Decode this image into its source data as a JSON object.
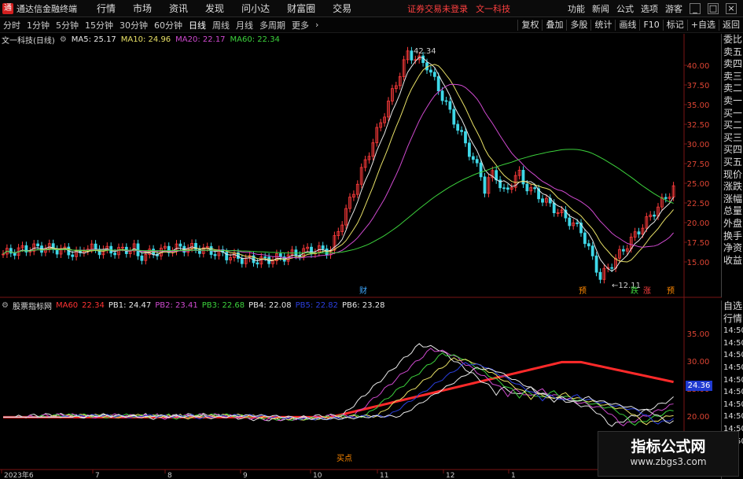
{
  "menubar": {
    "logo": "通",
    "app_title": "通达信金融终端",
    "items": [
      "行情",
      "市场",
      "资讯",
      "发现",
      "问小达",
      "财富圈",
      "交易"
    ],
    "notice": "证券交易未登录",
    "stock_name": "文一科技",
    "right_items": [
      "功能",
      "新闻",
      "公式",
      "选项",
      "游客"
    ]
  },
  "periods": [
    "分时",
    "1分钟",
    "5分钟",
    "15分钟",
    "30分钟",
    "60分钟",
    "日线",
    "周线",
    "月线",
    "多周期",
    "更多"
  ],
  "active_period": "日线",
  "toolbar": [
    "复权",
    "叠加",
    "多股",
    "统计",
    "画线",
    "F10",
    "标记",
    "+自选",
    "返回"
  ],
  "main_legend": {
    "title": "文一科技(日线)",
    "ma5": "MA5: 25.17",
    "ma10": "MA10: 24.96",
    "ma20": "MA20: 22.17",
    "ma60": "MA60: 22.34"
  },
  "sub_legend": {
    "title": "股票指标网",
    "ma60": "MA60",
    "ma60_val": "22.34",
    "pb1": "PB1: 24.47",
    "pb2": "PB2: 23.41",
    "pb3": "PB3: 22.68",
    "pb4": "PB4: 22.08",
    "pb5": "PB5: 22.82",
    "pb6": "PB6: 23.28"
  },
  "annotations": {
    "high": "42.34",
    "low": "12.11",
    "marker1": "财",
    "marker2": "预",
    "marker3": "跌",
    "marker4": "涨",
    "marker5": "预",
    "sub_marker": "买点",
    "price_tag": "24.36"
  },
  "main_axis": [
    "40.00",
    "37.50",
    "35.00",
    "32.50",
    "30.00",
    "27.50",
    "25.00",
    "22.50",
    "20.00",
    "17.50",
    "15.00"
  ],
  "sub_axis": [
    "35.00",
    "30.00",
    "25.00",
    "20.00"
  ],
  "time_axis": [
    "2023年6",
    "7",
    "8",
    "9",
    "10",
    "11",
    "12",
    "1"
  ],
  "sidebar_main": [
    "委比",
    "卖五",
    "卖四",
    "卖三",
    "卖二",
    "卖一",
    "买一",
    "买二",
    "买三",
    "买四",
    "买五",
    "现价",
    "涨跌",
    "涨幅",
    "总量",
    "外盘",
    "换手",
    "净资",
    "收益"
  ],
  "sidebar_sub": [
    "自选",
    "行情",
    "14:50",
    "14:50",
    "14:50",
    "14:50",
    "14:50",
    "14:50",
    "14:50",
    "14:50",
    "14:50",
    "14:50"
  ],
  "watermark": {
    "title": "指标公式网",
    "url": "www.zbgs3.com"
  },
  "colors": {
    "up": "#ff3b3b",
    "down": "#3fd8e8",
    "ma5": "#e8e8e8",
    "ma10": "#e8e066",
    "ma20": "#d04ad0",
    "ma60": "#3cd23c"
  }
}
